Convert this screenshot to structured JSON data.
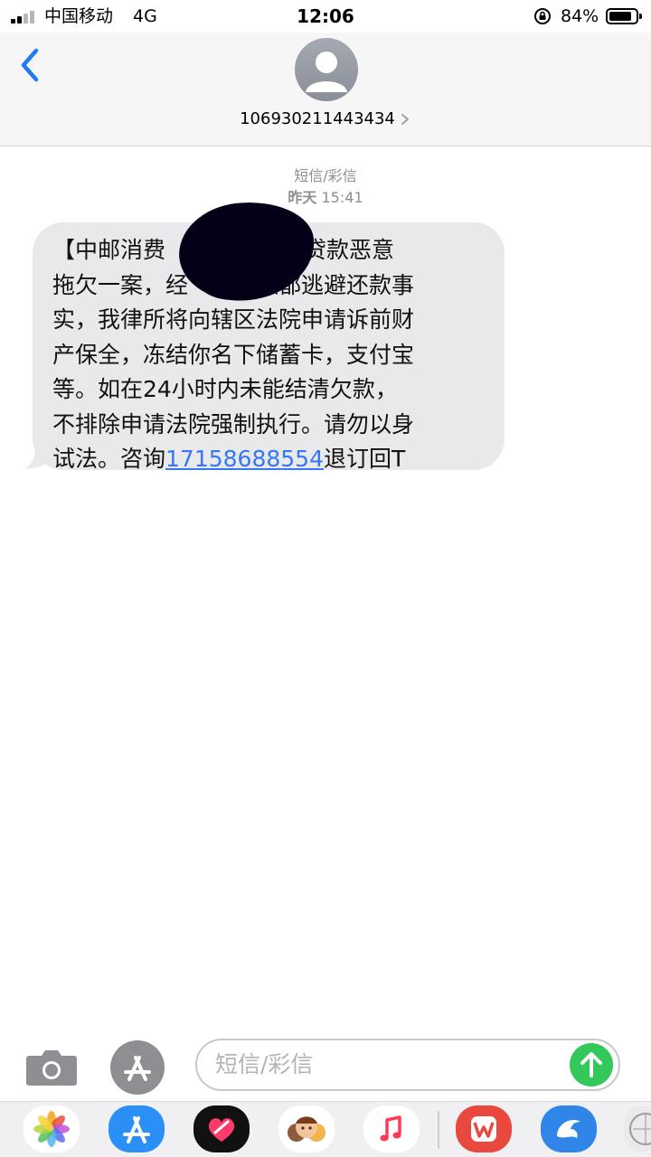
{
  "status_bar": {
    "carrier": "中国移动",
    "network": "4G",
    "time": "12:06",
    "battery_percent_label": "84%",
    "battery_level": 0.84
  },
  "header": {
    "contact_number": "106930211443434"
  },
  "conversation": {
    "message_type": "短信/彩信",
    "timestamp_day": "昨天",
    "timestamp_time": "15:41",
    "message": {
      "line1": "【中邮消费",
      "line1b": "关于你贷款恶意",
      "line2a": "拖欠一案，经",
      "line2b": "催缴都逃避还款事",
      "line3": "实，我律所将向辖区法院申请诉前财",
      "line4": "产保全，冻结你名下储蓄卡，支付宝",
      "line5": "等。如在24小时内未能结清欠款，",
      "line6": "不排除申请法院强制执行。请勿以身",
      "line7_prefix": "试法。咨询",
      "phone_link": "17158688554",
      "line7_suffix": "退订回T"
    }
  },
  "input_bar": {
    "placeholder": "短信/彩信"
  },
  "app_drawer": {
    "apps": [
      "photos-app",
      "app-store-app",
      "digital-touch-app",
      "memoji-app",
      "music-app",
      "wps-app",
      "dolphin-app",
      "more-app"
    ]
  },
  "colors": {
    "bubble_gray": "#e9e9eb",
    "link_blue": "#3478f6",
    "send_green": "#34c759",
    "accent_blue": "#1f7cf2"
  }
}
